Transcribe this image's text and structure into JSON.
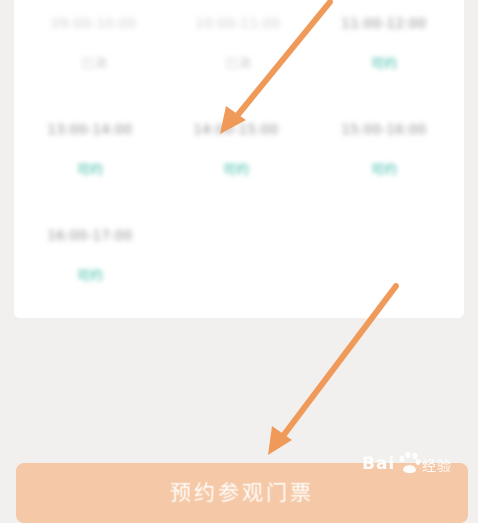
{
  "time_slots": [
    {
      "time": "09:00-10:00",
      "status": "已满",
      "available": false
    },
    {
      "time": "10:00-11:00",
      "status": "已满",
      "available": false
    },
    {
      "time": "11:00-12:00",
      "status": "可约",
      "available": true
    },
    {
      "time": "13:00-14:00",
      "status": "可约",
      "available": true
    },
    {
      "time": "14:00-15:00",
      "status": "可约",
      "available": true
    },
    {
      "time": "15:00-16:00",
      "status": "可约",
      "available": true
    },
    {
      "time": "16:00-17:00",
      "status": "可约",
      "available": true
    }
  ],
  "book_button": {
    "label": "预约参观门票"
  },
  "watermark": {
    "text": "Bai 经验",
    "brand": "Bai",
    "suffix": "经验"
  },
  "colors": {
    "available": "#36b9a5",
    "button": "#f5c9a7",
    "arrow": "#f09a5a",
    "background": "#f1f0ef"
  }
}
